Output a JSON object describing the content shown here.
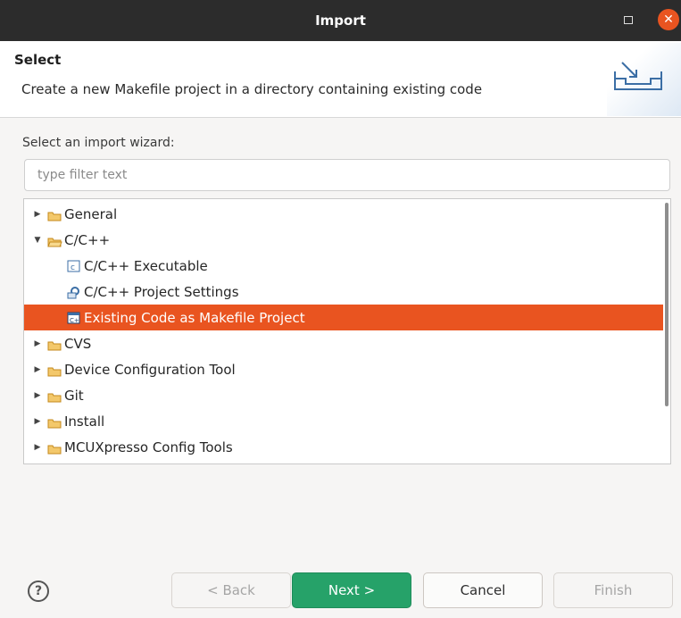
{
  "window": {
    "title": "Import",
    "maximize_icon": "maximize-icon",
    "close_icon": "close-icon"
  },
  "header": {
    "title": "Select",
    "description": "Create a new Makefile project in a directory containing existing code",
    "banner_icon": "import-wizard-banner-icon"
  },
  "wizard": {
    "label": "Select an import wizard:",
    "filter_placeholder": "type filter text",
    "filter_value": ""
  },
  "tree": {
    "items": [
      {
        "label": "General",
        "level": 0,
        "expanded": false,
        "icon": "folder-icon"
      },
      {
        "label": "C/C++",
        "level": 0,
        "expanded": true,
        "icon": "folder-open-icon"
      },
      {
        "label": "C/C++ Executable",
        "level": 1,
        "icon": "executable-icon"
      },
      {
        "label": "C/C++ Project Settings",
        "level": 1,
        "icon": "settings-icon"
      },
      {
        "label": "Existing Code as Makefile Project",
        "level": 1,
        "icon": "makefile-project-icon",
        "selected": true
      },
      {
        "label": "CVS",
        "level": 0,
        "expanded": false,
        "icon": "folder-icon"
      },
      {
        "label": "Device Configuration Tool",
        "level": 0,
        "expanded": false,
        "icon": "folder-icon"
      },
      {
        "label": "Git",
        "level": 0,
        "expanded": false,
        "icon": "folder-icon"
      },
      {
        "label": "Install",
        "level": 0,
        "expanded": false,
        "icon": "folder-icon"
      },
      {
        "label": "MCUXpresso Config Tools",
        "level": 0,
        "expanded": false,
        "icon": "folder-icon"
      }
    ]
  },
  "buttons": {
    "back": "< Back",
    "next": "Next >",
    "cancel": "Cancel",
    "finish": "Finish",
    "help_icon": "help-icon"
  },
  "colors": {
    "accent": "#e95420",
    "primary": "#26a269",
    "titlebar": "#2c2c2c"
  }
}
